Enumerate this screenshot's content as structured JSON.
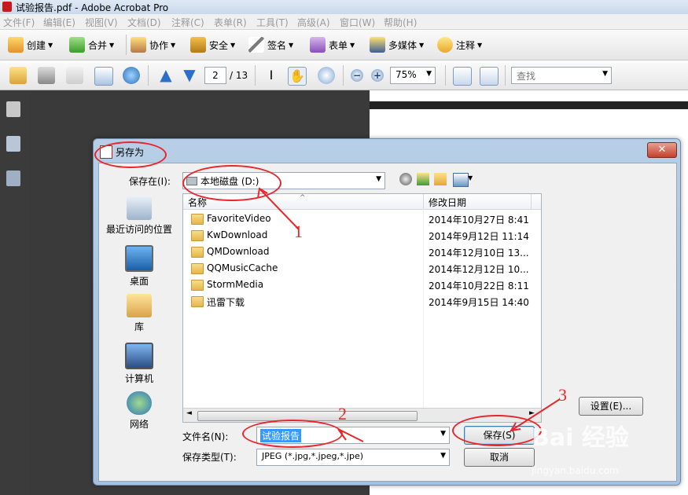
{
  "window": {
    "title": "试验报告.pdf - Adobe Acrobat Pro"
  },
  "menu": [
    "文件(F)",
    "编辑(E)",
    "视图(V)",
    "文档(D)",
    "注释(C)",
    "表单(R)",
    "工具(T)",
    "高级(A)",
    "窗口(W)",
    "帮助(H)"
  ],
  "toolbar1": [
    {
      "label": "创建"
    },
    {
      "label": "合并"
    },
    {
      "label": "协作"
    },
    {
      "label": "安全"
    },
    {
      "label": "签名"
    },
    {
      "label": "表单"
    },
    {
      "label": "多媒体"
    },
    {
      "label": "注释"
    }
  ],
  "toolbar2": {
    "page_current": "2",
    "page_total": "/ 13",
    "zoom": "75%",
    "search_placeholder": "查找"
  },
  "dialog": {
    "title": "另存为",
    "save_in_label": "保存在(I):",
    "save_in_value": "本地磁盘 (D:)",
    "places": [
      "最近访问的位置",
      "桌面",
      "库",
      "计算机",
      "网络"
    ],
    "columns": {
      "name": "名称",
      "modified": "修改日期"
    },
    "files": [
      {
        "name": "FavoriteVideo",
        "date": "2014年10月27日 8:41"
      },
      {
        "name": "KwDownload",
        "date": "2014年9月12日 11:14"
      },
      {
        "name": "QMDownload",
        "date": "2014年12月10日 13..."
      },
      {
        "name": "QQMusicCache",
        "date": "2014年12月12日 10..."
      },
      {
        "name": "StormMedia",
        "date": "2014年10月22日 8:11"
      },
      {
        "name": "迅雷下载",
        "date": "2014年9月15日 14:40"
      }
    ],
    "filename_label": "文件名(N):",
    "filename_value": "试验报告",
    "filetype_label": "保存类型(T):",
    "filetype_value": "JPEG (*.jpg,*.jpeg,*.jpe)",
    "settings_button": "设置(E)...",
    "save_button": "保存(S)",
    "cancel_button": "取消"
  },
  "annotations": [
    "1",
    "2",
    "3"
  ],
  "watermark": {
    "brand": "Bai 经验",
    "url": "jingyan.baidu.com"
  },
  "colors": {
    "annotation": "#e8262b",
    "dialog_frame": "#a5c1de",
    "selection": "#3399ff"
  }
}
